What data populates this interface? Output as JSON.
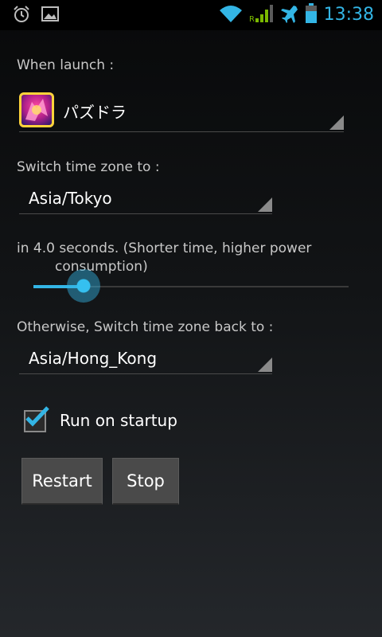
{
  "status_bar": {
    "time": "13:38",
    "icons": [
      "alarm-icon",
      "image-icon",
      "wifi-icon",
      "signal-roaming-icon",
      "airplane-icon",
      "battery-icon"
    ],
    "accent_color": "#33b5e5"
  },
  "launch": {
    "label": "When launch :",
    "app_name": "パズドラ"
  },
  "timezone": {
    "label": "Switch time zone to :",
    "value": "Asia/Tokyo"
  },
  "delay": {
    "label": "in 4.0 seconds. (Shorter time, higher power",
    "label_cont": "consumption)",
    "slider_fraction": 0.16
  },
  "revert": {
    "label": "Otherwise, Switch time zone back to :",
    "value": "Asia/Hong_Kong"
  },
  "startup": {
    "label": "Run on startup",
    "checked": true
  },
  "buttons": {
    "restart": "Restart",
    "stop": "Stop"
  }
}
